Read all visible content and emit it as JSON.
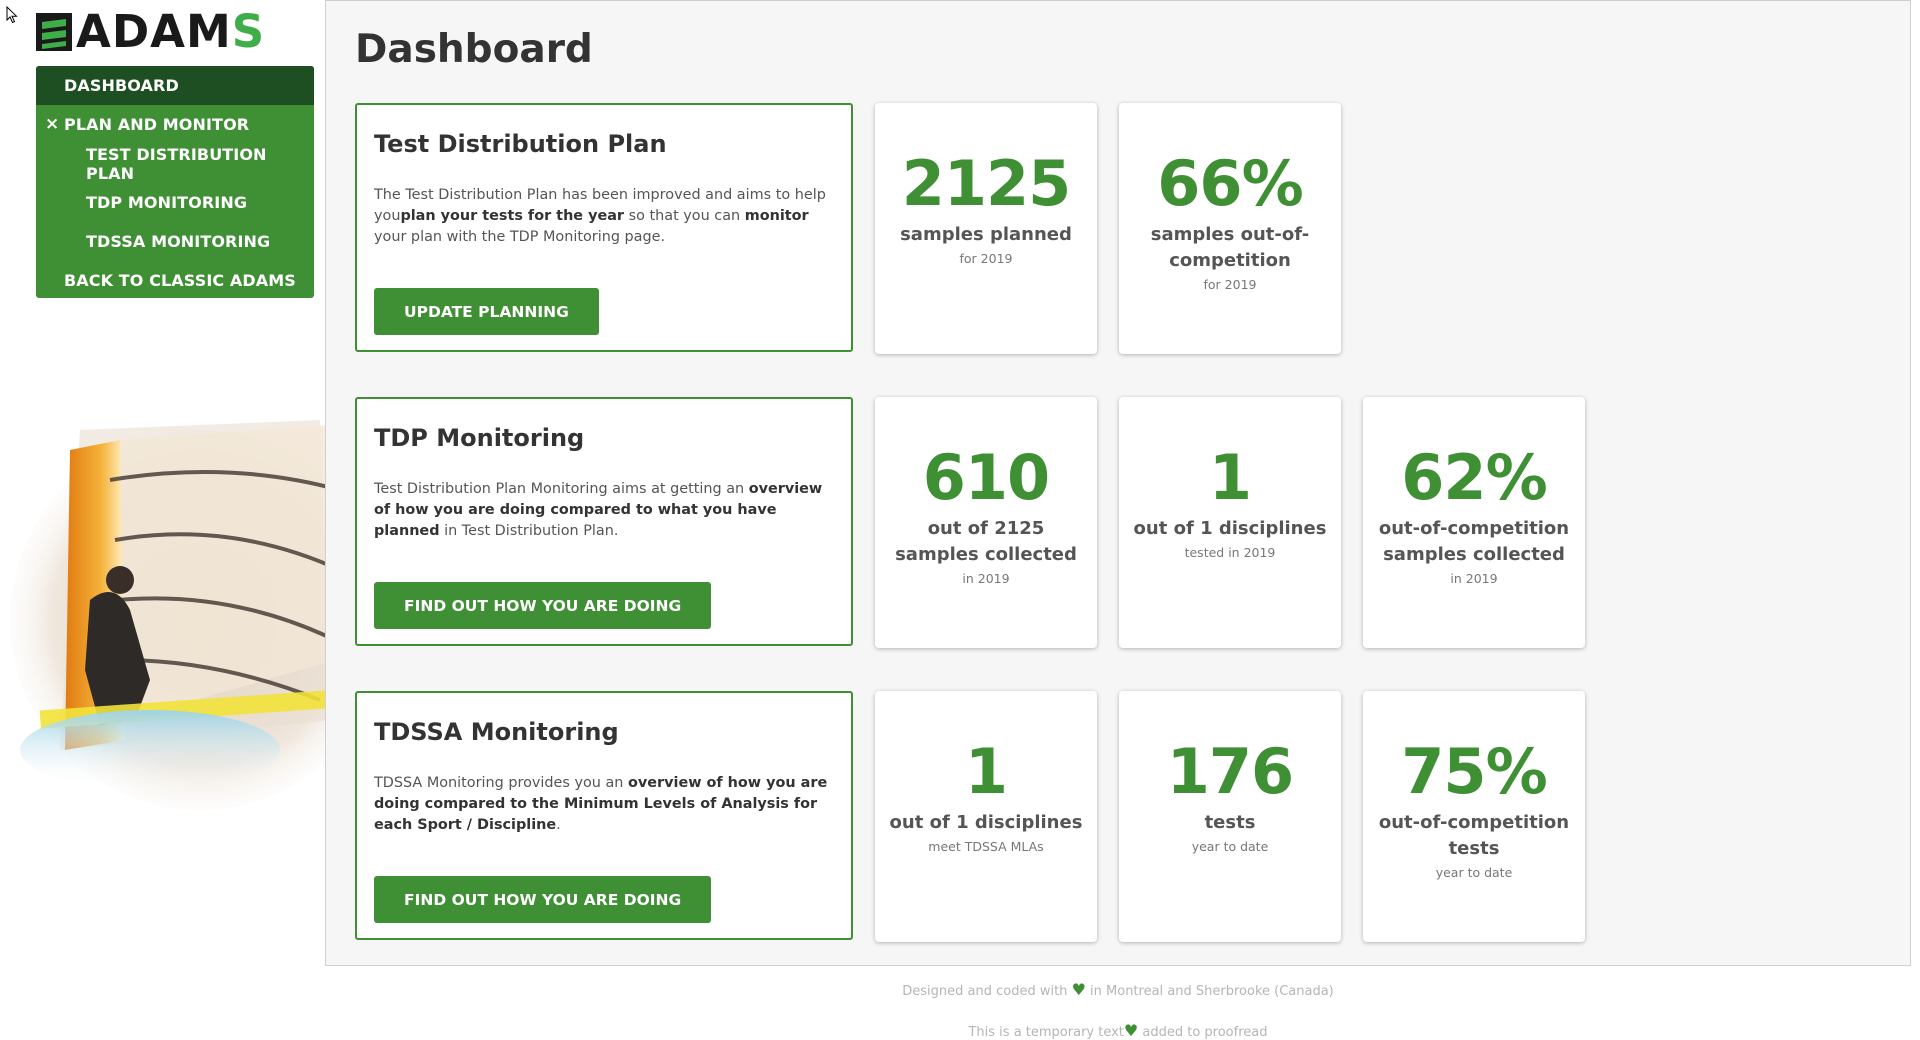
{
  "logo": {
    "text_main": "ADAM",
    "text_end": "S"
  },
  "nav": {
    "items": [
      {
        "label": "DASHBOARD"
      },
      {
        "label": "PLAN AND MONITOR",
        "toggle": "×"
      },
      {
        "label": "TEST DISTRIBUTION PLAN"
      },
      {
        "label": "TDP MONITORING"
      },
      {
        "label": "TDSSA MONITORING"
      },
      {
        "label": "BACK TO CLASSIC ADAMS"
      }
    ]
  },
  "main": {
    "title": "Dashboard",
    "sections": [
      {
        "heading": "Test Distribution Plan",
        "text": [
          {
            "t": "The Test Distribution Plan has been improved and aims to help you"
          },
          {
            "t": "plan your tests for the year",
            "b": true
          },
          {
            "t": " so that you can "
          },
          {
            "t": "monitor",
            "b": true
          },
          {
            "t": " your plan with the TDP Monitoring page."
          }
        ],
        "button": "UPDATE PLANNING",
        "stats": [
          {
            "value": "2125",
            "label": "samples planned",
            "sub": "for 2019"
          },
          {
            "value": "66%",
            "label": "samples out-of-competition",
            "sub": "for 2019"
          }
        ]
      },
      {
        "heading": "TDP Monitoring",
        "text": [
          {
            "t": "Test Distribution Plan Monitoring aims at getting an "
          },
          {
            "t": "overview of how you are doing compared to what you have planned",
            "b": true
          },
          {
            "t": " in Test Distribution Plan."
          }
        ],
        "button": "FIND OUT HOW YOU ARE DOING",
        "stats": [
          {
            "value": "610",
            "label": "out of 2125 samples collected",
            "sub": "in 2019"
          },
          {
            "value": "1",
            "label": "out of 1 disciplines",
            "sub": "tested in 2019"
          },
          {
            "value": "62%",
            "label": "out-of-competition samples collected",
            "sub": "in 2019"
          }
        ]
      },
      {
        "heading": "TDSSA Monitoring",
        "text": [
          {
            "t": "TDSSA Monitoring provides you an "
          },
          {
            "t": "overview of how you are doing compared to the Minimum Levels of Analysis for each Sport / Discipline",
            "b": true
          },
          {
            "t": "."
          }
        ],
        "button": "FIND OUT HOW YOU ARE DOING",
        "stats": [
          {
            "value": "1",
            "label": "out of 1 disciplines",
            "sub": "meet TDSSA MLAs"
          },
          {
            "value": "176",
            "label": "tests",
            "sub": "year to date"
          },
          {
            "value": "75%",
            "label": "out-of-competition tests",
            "sub": "year to date"
          }
        ]
      }
    ]
  },
  "footer": {
    "line1_pre": "Designed and coded with",
    "line1_post": " in Montreal and Sherbrooke (Canada)",
    "line2_pre": "This is a temporary text",
    "line2_post": " added to proofread",
    "heart": "♥"
  },
  "colors": {
    "brand_green": "#3f8f35",
    "nav_active": "#1e4f22",
    "logo_accent": "#3fae49"
  },
  "icons": {
    "cursor": "arrow-cursor-icon",
    "heart": "heart-icon",
    "close": "close-icon",
    "logo": "adams-logo-icon"
  }
}
